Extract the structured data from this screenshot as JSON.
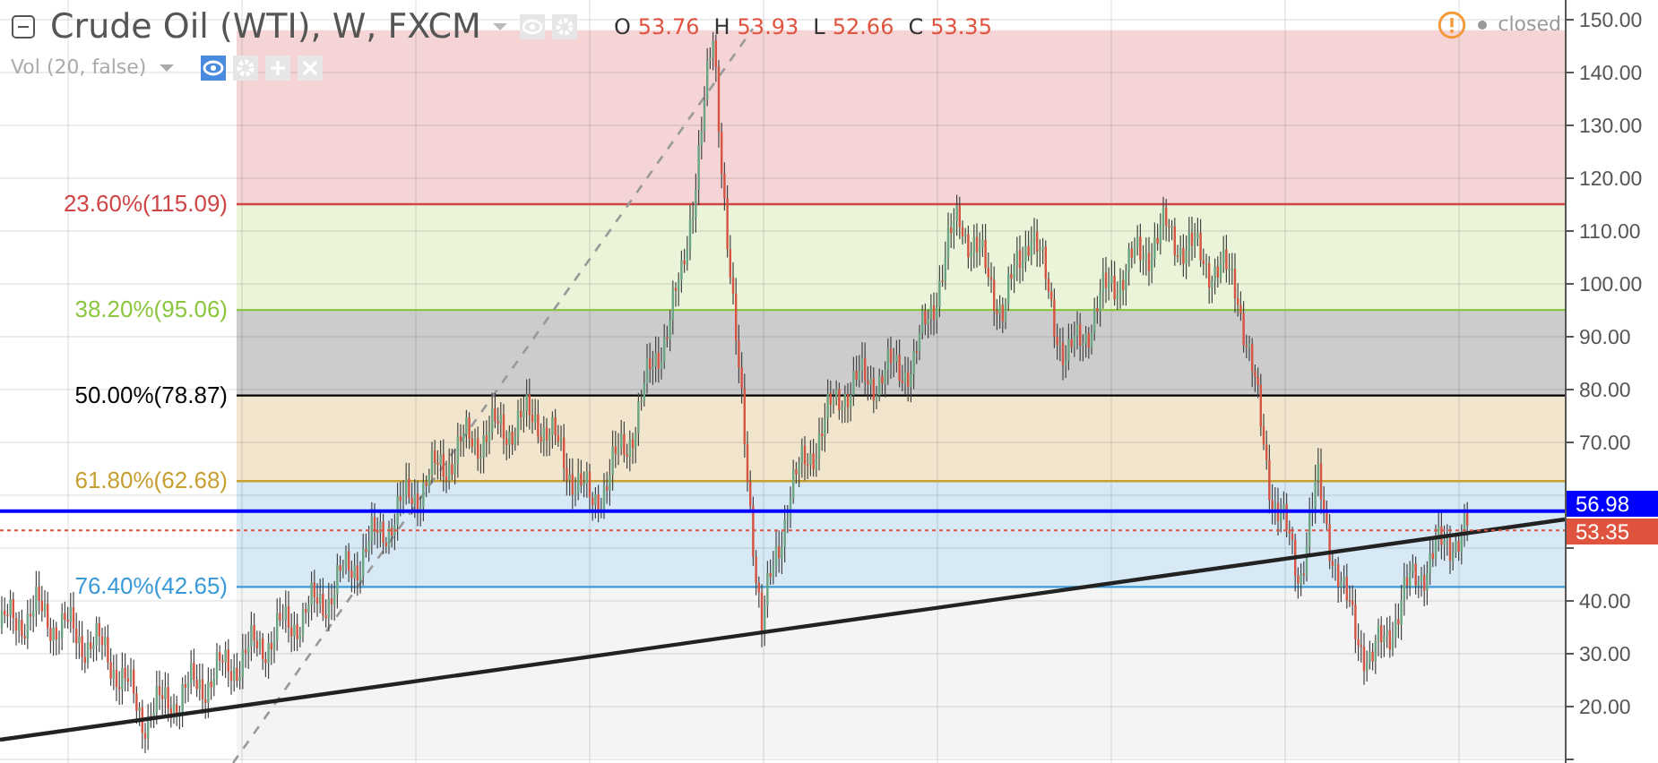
{
  "legend": {
    "title": "Crude Oil (WTI), W, FXCM",
    "ohlc": [
      {
        "label": "O",
        "value": "53.76"
      },
      {
        "label": "H",
        "value": "53.93"
      },
      {
        "label": "L",
        "value": "52.66"
      },
      {
        "label": "C",
        "value": "53.35"
      }
    ],
    "indicator": "Vol (20, false)",
    "market_status": "closed"
  },
  "fib_levels": [
    {
      "label": "23.60%(115.09)",
      "color": "#d04545"
    },
    {
      "label": "38.20%(95.06)",
      "color": "#8cc63f"
    },
    {
      "label": "50.00%(78.87)",
      "color": "#000000"
    },
    {
      "label": "61.80%(62.68)",
      "color": "#c8a032"
    },
    {
      "label": "76.40%(42.65)",
      "color": "#3a9ad9"
    }
  ],
  "price_axis": [
    "150.00",
    "140.00",
    "130.00",
    "120.00",
    "110.00",
    "100.00",
    "90.00",
    "80.00",
    "70.00"
  ],
  "price_axis_lower": [
    "40.00",
    "30.00",
    "20.00"
  ],
  "price_labels": [
    {
      "value": "56.98",
      "color": "#0000ff"
    },
    {
      "value": "53.35",
      "color": "#e0533f"
    }
  ]
}
